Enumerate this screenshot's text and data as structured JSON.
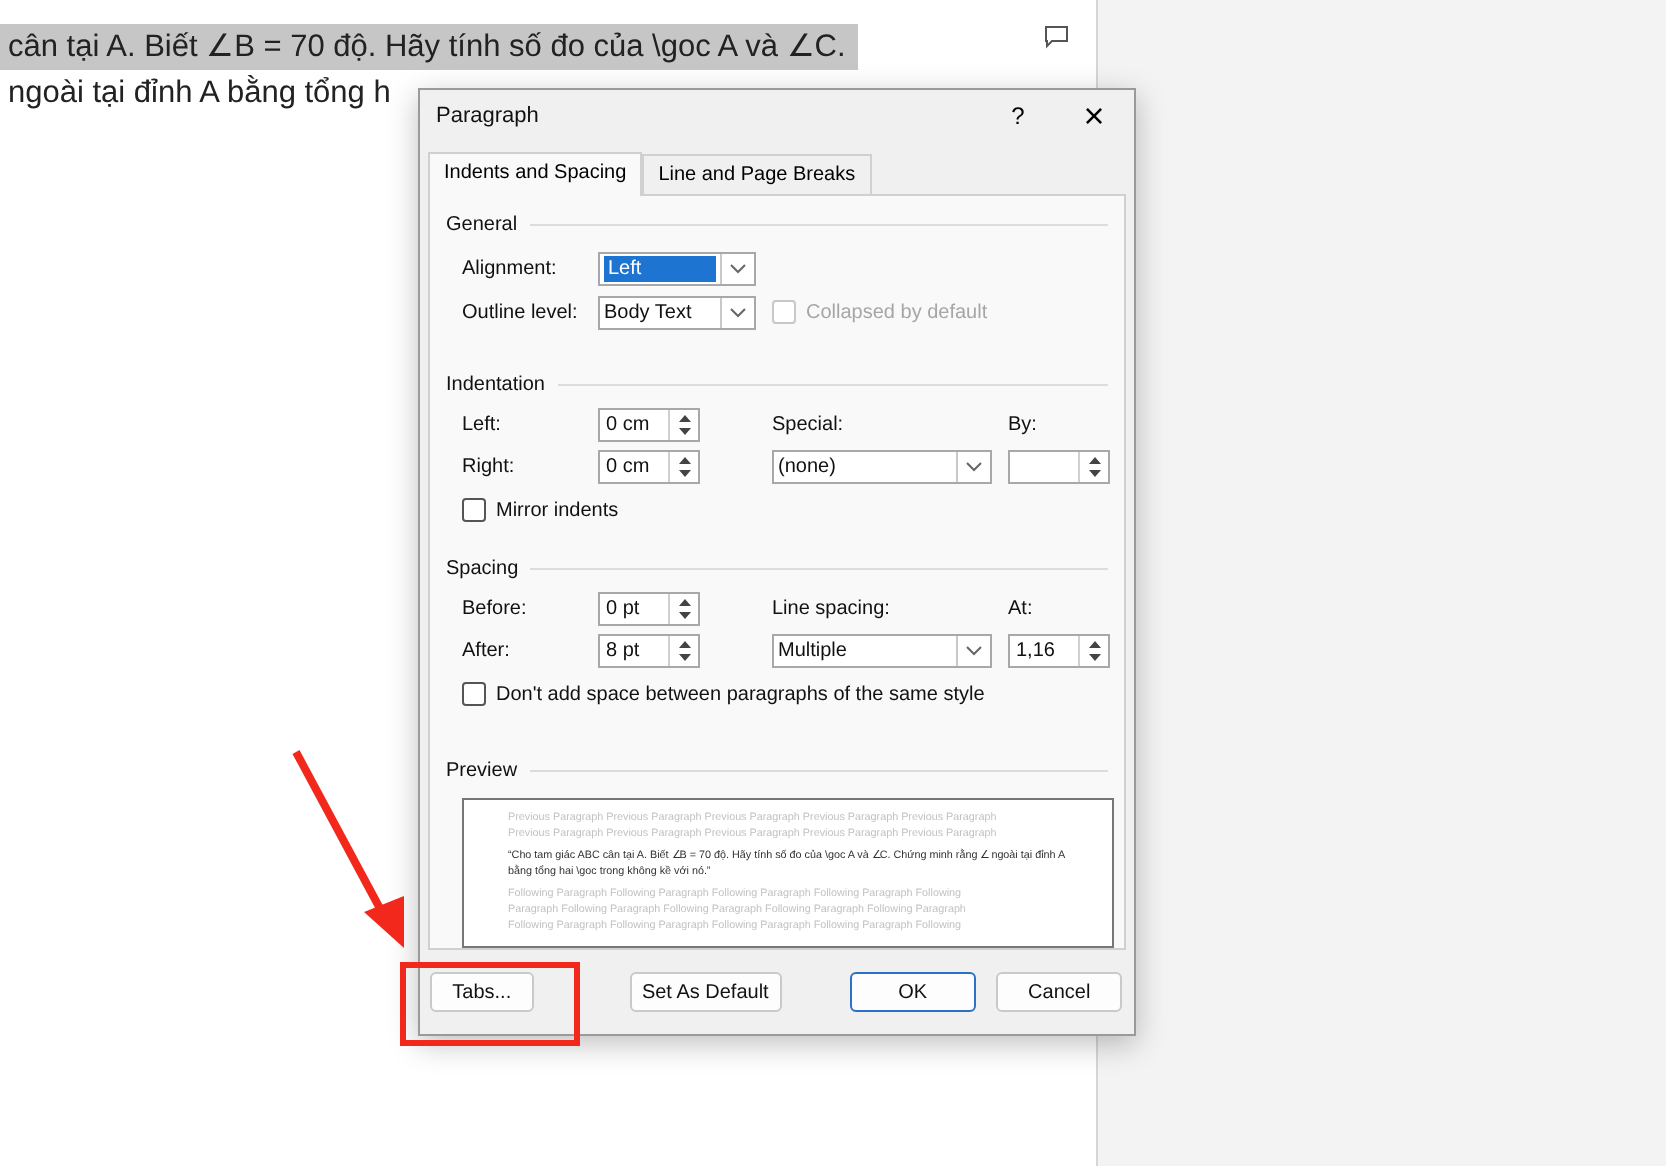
{
  "document": {
    "lines": [
      {
        "text": "cân tại A. Biết ∠B = 70 độ. Hãy tính số đo của \\goc A và ∠C.",
        "selected": true
      },
      {
        "text": "ngoài tại đỉnh A bằng tổng h",
        "selected": false
      }
    ]
  },
  "dialog": {
    "title": "Paragraph",
    "help": "?",
    "close": "×",
    "tabs": [
      {
        "label": "Indents and Spacing",
        "selected": true
      },
      {
        "label": "Line and Page Breaks",
        "selected": false
      }
    ],
    "general": {
      "heading": "General",
      "alignment": {
        "label": "Alignment:",
        "value": "Left",
        "highlighted": true
      },
      "outline": {
        "label": "Outline level:",
        "value": "Body Text",
        "highlighted": false
      },
      "collapsed": {
        "label": "Collapsed by default",
        "checked": false,
        "disabled": true
      }
    },
    "indentation": {
      "heading": "Indentation",
      "left": {
        "label": "Left:",
        "value": "0 cm"
      },
      "right": {
        "label": "Right:",
        "value": "0 cm"
      },
      "special": {
        "label": "Special:",
        "value": "(none)",
        "highlighted": false
      },
      "by": {
        "label": "By:"
      },
      "mirror": {
        "label": "Mirror indents",
        "checked": false,
        "disabled": false
      }
    },
    "spacing": {
      "heading": "Spacing",
      "before": {
        "label": "Before:",
        "value": "0 pt"
      },
      "after": {
        "label": "After:",
        "value": "8 pt"
      },
      "line_spacing": {
        "label": "Line spacing:",
        "value": "Multiple",
        "highlighted": false
      },
      "at": {
        "label": "At:",
        "value": "1,16"
      },
      "dont_add": {
        "label": "Don't add space between paragraphs of the same style",
        "checked": false,
        "disabled": false
      }
    },
    "preview": {
      "heading": "Preview",
      "previous": [
        "Previous Paragraph Previous Paragraph Previous Paragraph Previous Paragraph Previous Paragraph",
        "Previous Paragraph Previous Paragraph Previous Paragraph Previous Paragraph Previous Paragraph"
      ],
      "sample": "“Cho tam giác ABC cân tại A. Biết ∠B = 70 độ. Hãy tính số đo của \\goc A và ∠C. Chứng minh rằng ∠ ngoài tại đỉnh A bằng tổng hai \\goc trong không kề với nó.”",
      "following": [
        "Following Paragraph Following Paragraph Following Paragraph Following Paragraph Following",
        "Paragraph Following Paragraph Following Paragraph Following Paragraph Following Paragraph",
        "Following Paragraph Following Paragraph Following Paragraph Following Paragraph Following"
      ]
    },
    "buttons": [
      {
        "label": "Tabs...",
        "default": false
      },
      {
        "label": "Set As Default",
        "default": false
      },
      {
        "label": "OK",
        "default": true
      },
      {
        "label": "Cancel",
        "default": false
      }
    ]
  }
}
